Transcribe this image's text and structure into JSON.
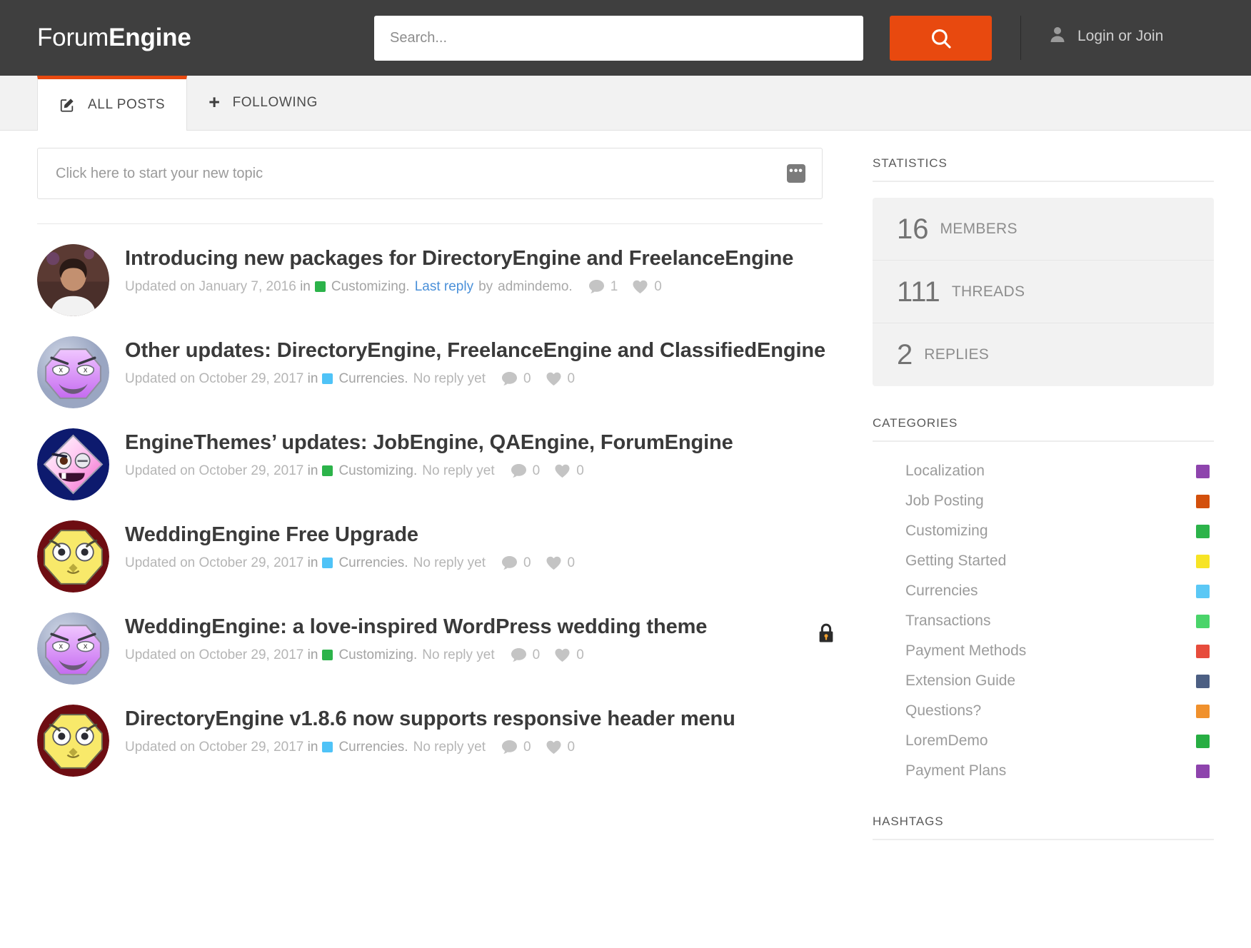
{
  "header": {
    "logo_light": "Forum",
    "logo_bold": "Engine",
    "search_placeholder": "Search...",
    "search_value": "",
    "search_icon": "search-icon",
    "user_icon": "user-icon",
    "login_label": "Login or Join"
  },
  "tabs": [
    {
      "label": "ALL POSTS",
      "icon": "compose-icon",
      "active": true
    },
    {
      "label": "FOLLOWING",
      "icon": "plus-icon",
      "active": false
    }
  ],
  "new_topic": {
    "placeholder": "Click here to start your new topic",
    "more_icon": "ellipsis-icon",
    "more_label": "•••"
  },
  "posts": [
    {
      "title": "Introducing new packages for DirectoryEngine and FreelanceEngine",
      "updated_prefix": "Updated on",
      "date": "January 7, 2016",
      "in_word": "in",
      "category": "Customizing.",
      "category_color": "#2cb34a",
      "last_reply": "Last reply",
      "by_word": "by",
      "author": "admindemo.",
      "no_reply": "",
      "comments": "1",
      "likes": "0",
      "locked": false,
      "avatar_type": "photo"
    },
    {
      "title": "Other updates: DirectoryEngine, FreelanceEngine and ClassifiedEngine",
      "updated_prefix": "Updated on",
      "date": "October 29, 2017",
      "in_word": "in",
      "category": "Currencies.",
      "category_color": "#4fc3f7",
      "last_reply": "",
      "by_word": "",
      "author": "",
      "no_reply": "No  reply  yet",
      "comments": "0",
      "likes": "0",
      "locked": false,
      "avatar_type": "monster-purple"
    },
    {
      "title": "EngineThemes’ updates: JobEngine, QAEngine, ForumEngine",
      "updated_prefix": "Updated on",
      "date": "October 29, 2017",
      "in_word": "in",
      "category": "Customizing.",
      "category_color": "#2cb34a",
      "last_reply": "",
      "by_word": "",
      "author": "",
      "no_reply": "No  reply  yet",
      "comments": "0",
      "likes": "0",
      "locked": false,
      "avatar_type": "monster-diamond"
    },
    {
      "title": "WeddingEngine Free Upgrade",
      "updated_prefix": "Updated on",
      "date": "October 29, 2017",
      "in_word": "in",
      "category": "Currencies.",
      "category_color": "#4fc3f7",
      "last_reply": "",
      "by_word": "",
      "author": "",
      "no_reply": "No  reply  yet",
      "comments": "0",
      "likes": "0",
      "locked": false,
      "avatar_type": "monster-yellow"
    },
    {
      "title": "WeddingEngine: a love-inspired WordPress wedding theme",
      "updated_prefix": "Updated on",
      "date": "October 29, 2017",
      "in_word": "in",
      "category": "Customizing.",
      "category_color": "#2cb34a",
      "last_reply": "",
      "by_word": "",
      "author": "",
      "no_reply": "No  reply  yet",
      "comments": "0",
      "likes": "0",
      "locked": true,
      "avatar_type": "monster-purple"
    },
    {
      "title": "DirectoryEngine v1.8.6 now supports responsive header menu",
      "updated_prefix": "Updated on",
      "date": "October 29, 2017",
      "in_word": "in",
      "category": "Currencies.",
      "category_color": "#4fc3f7",
      "last_reply": "",
      "by_word": "",
      "author": "",
      "no_reply": "No  reply  yet",
      "comments": "0",
      "likes": "0",
      "locked": false,
      "avatar_type": "monster-yellow"
    }
  ],
  "sidebar": {
    "statistics_title": "STATISTICS",
    "stats": [
      {
        "number": "16",
        "label": "MEMBERS"
      },
      {
        "number": "111",
        "label": "THREADS"
      },
      {
        "number": "2",
        "label": "REPLIES"
      }
    ],
    "categories_title": "CATEGORIES",
    "categories": [
      {
        "label": "Localization",
        "color": "#8e44ad"
      },
      {
        "label": "Job Posting",
        "color": "#d3500c"
      },
      {
        "label": "Customizing",
        "color": "#2cb34a"
      },
      {
        "label": "Getting Started",
        "color": "#f7e425"
      },
      {
        "label": "Currencies",
        "color": "#5bc8f5"
      },
      {
        "label": "Transactions",
        "color": "#4ad46a"
      },
      {
        "label": "Payment Methods",
        "color": "#e74c3c"
      },
      {
        "label": "Extension Guide",
        "color": "#4c5f83"
      },
      {
        "label": "Questions?",
        "color": "#f0912d"
      },
      {
        "label": "LoremDemo",
        "color": "#27ae43"
      },
      {
        "label": "Payment Plans",
        "color": "#8e44ad"
      }
    ],
    "hashtags_title": "HASHTAGS"
  },
  "colors": {
    "brand_orange": "#e8490f",
    "header_bg": "#3f3f3f",
    "link_blue": "#4a90d9"
  }
}
